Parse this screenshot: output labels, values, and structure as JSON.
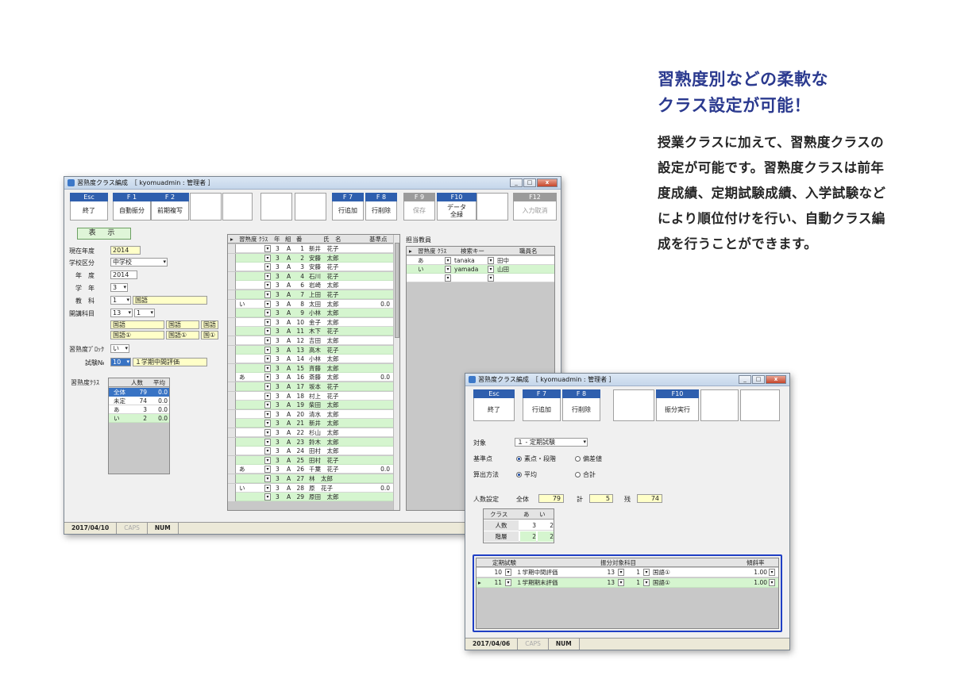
{
  "promo": {
    "headline": [
      "習熟度別などの柔軟な",
      "クラス設定が可能！"
    ],
    "body": "授業クラスに加えて、習熟度クラスの設定が可能です。習熟度クラスは前年度成績、定期試験成績、入学試験などにより順位付けを行い、自動クラス編成を行うことができます。"
  },
  "win1": {
    "title": "習熟度クラス編成　［ kyomuadmin : 管理者 ］",
    "fkeys": [
      {
        "key": "Esc",
        "label": "終了",
        "enabled": true
      },
      {
        "key": "F 1",
        "label": "自動振分",
        "enabled": true
      },
      {
        "key": "F 2",
        "label": "前期複写",
        "enabled": true
      },
      {
        "key": "F 7",
        "label": "行追加",
        "enabled": true
      },
      {
        "key": "F 8",
        "label": "行削除",
        "enabled": true
      },
      {
        "key": "F 9",
        "label": "保存",
        "enabled": false
      },
      {
        "key": "F10",
        "label": "データ\n全緑",
        "enabled": true
      },
      {
        "key": "F12",
        "label": "入力取消",
        "enabled": false
      }
    ],
    "show_button": "表 示",
    "form": {
      "current_year_label": "現在年度",
      "current_year": "2014",
      "school_type_label": "学校区分",
      "school_type": "中学校",
      "year_label": "年　度",
      "year": "2014",
      "grade_label": "学　年",
      "grade": "3",
      "subject_label": "教　科",
      "subject_code": "1",
      "subject_name": "国語",
      "course_label": "開講科目",
      "course_code": "13",
      "course_sub": "1",
      "course_names": [
        "国語",
        "国語",
        "国語",
        "国語①",
        "国語①",
        "国①"
      ],
      "block_label": "習熟度ﾌﾞﾛｯｸ",
      "block": "い",
      "exam_label": "試験№",
      "exam_no": "10",
      "exam_name": "１学期中間評価"
    },
    "summary": {
      "label": "習熟度ｸﾗｽ",
      "headers": [
        "人数",
        "平均"
      ],
      "rows": [
        {
          "name": "全体",
          "count": "79",
          "avg": "0.0"
        },
        {
          "name": "未定",
          "count": "74",
          "avg": "0.0"
        },
        {
          "name": "あ",
          "count": "3",
          "avg": "0.0"
        },
        {
          "name": "い",
          "count": "2",
          "avg": "0.0"
        }
      ]
    },
    "students": {
      "headers": [
        "習熟度 ｸﾗｽ",
        "年",
        "組",
        "番",
        "氏　名",
        "基準点"
      ],
      "rows": [
        {
          "cls": "",
          "y": "3",
          "k": "A",
          "n": "1",
          "name": "新井　花子",
          "pt": ""
        },
        {
          "cls": "",
          "y": "3",
          "k": "A",
          "n": "2",
          "name": "安藤　太郎",
          "pt": ""
        },
        {
          "cls": "",
          "y": "3",
          "k": "A",
          "n": "3",
          "name": "安藤　花子",
          "pt": ""
        },
        {
          "cls": "",
          "y": "3",
          "k": "A",
          "n": "4",
          "name": "石川　花子",
          "pt": ""
        },
        {
          "cls": "",
          "y": "3",
          "k": "A",
          "n": "6",
          "name": "岩崎　太郎",
          "pt": ""
        },
        {
          "cls": "",
          "y": "3",
          "k": "A",
          "n": "7",
          "name": "上田　花子",
          "pt": ""
        },
        {
          "cls": "い",
          "y": "3",
          "k": "A",
          "n": "8",
          "name": "太田　太郎",
          "pt": "0.0"
        },
        {
          "cls": "",
          "y": "3",
          "k": "A",
          "n": "9",
          "name": "小林　太郎",
          "pt": ""
        },
        {
          "cls": "",
          "y": "3",
          "k": "A",
          "n": "10",
          "name": "金子　太郎",
          "pt": ""
        },
        {
          "cls": "",
          "y": "3",
          "k": "A",
          "n": "11",
          "name": "木下　花子",
          "pt": ""
        },
        {
          "cls": "",
          "y": "3",
          "k": "A",
          "n": "12",
          "name": "吉田　太郎",
          "pt": ""
        },
        {
          "cls": "",
          "y": "3",
          "k": "A",
          "n": "13",
          "name": "高木　花子",
          "pt": ""
        },
        {
          "cls": "",
          "y": "3",
          "k": "A",
          "n": "14",
          "name": "小林　太郎",
          "pt": ""
        },
        {
          "cls": "",
          "y": "3",
          "k": "A",
          "n": "15",
          "name": "斉藤　太郎",
          "pt": ""
        },
        {
          "cls": "あ",
          "y": "3",
          "k": "A",
          "n": "16",
          "name": "斎藤　太郎",
          "pt": "0.0"
        },
        {
          "cls": "",
          "y": "3",
          "k": "A",
          "n": "17",
          "name": "坂本　花子",
          "pt": ""
        },
        {
          "cls": "",
          "y": "3",
          "k": "A",
          "n": "18",
          "name": "村上　花子",
          "pt": ""
        },
        {
          "cls": "",
          "y": "3",
          "k": "A",
          "n": "19",
          "name": "柴田　太郎",
          "pt": ""
        },
        {
          "cls": "",
          "y": "3",
          "k": "A",
          "n": "20",
          "name": "清水　太郎",
          "pt": ""
        },
        {
          "cls": "",
          "y": "3",
          "k": "A",
          "n": "21",
          "name": "新井　太郎",
          "pt": ""
        },
        {
          "cls": "",
          "y": "3",
          "k": "A",
          "n": "22",
          "name": "杉山　太郎",
          "pt": ""
        },
        {
          "cls": "",
          "y": "3",
          "k": "A",
          "n": "23",
          "name": "鈴木　太郎",
          "pt": ""
        },
        {
          "cls": "",
          "y": "3",
          "k": "A",
          "n": "24",
          "name": "田村　太郎",
          "pt": ""
        },
        {
          "cls": "",
          "y": "3",
          "k": "A",
          "n": "25",
          "name": "田村　花子",
          "pt": ""
        },
        {
          "cls": "あ",
          "y": "3",
          "k": "A",
          "n": "26",
          "name": "千葉　花子",
          "pt": "0.0"
        },
        {
          "cls": "",
          "y": "3",
          "k": "A",
          "n": "27",
          "name": "林　太郎",
          "pt": ""
        },
        {
          "cls": "い",
          "y": "3",
          "k": "A",
          "n": "28",
          "name": "原　花子",
          "pt": "0.0"
        },
        {
          "cls": "",
          "y": "3",
          "k": "A",
          "n": "29",
          "name": "原田　太郎",
          "pt": ""
        }
      ]
    },
    "teachers": {
      "label": "担当教員",
      "headers": [
        "習熟度 ｸﾗｽ",
        "検索キー",
        "職員名"
      ],
      "rows": [
        {
          "cls": "あ",
          "key": "tanaka",
          "name": "田中"
        },
        {
          "cls": "い",
          "key": "yamada",
          "name": "山田"
        },
        {
          "cls": "",
          "key": "",
          "name": ""
        }
      ]
    },
    "status": {
      "date": "2017/04/10",
      "caps": "CAPS",
      "num": "NUM"
    }
  },
  "win2": {
    "title": "習熟度クラス編成　［ kyomuadmin : 管理者 ］",
    "fkeys": [
      {
        "key": "Esc",
        "label": "終了"
      },
      {
        "key": "F 7",
        "label": "行追加"
      },
      {
        "key": "F 8",
        "label": "行削除"
      },
      {
        "key": "F10",
        "label": "振分実行"
      }
    ],
    "target_label": "対象",
    "target": "１ - 定期試験",
    "basis_label": "基準点",
    "basis_opt1": "素点・段階",
    "basis_opt2": "偏差値",
    "calc_label": "算出方法",
    "calc_opt1": "平均",
    "calc_opt2": "合計",
    "count_label": "人数設定",
    "total_label": "全体",
    "total": "79",
    "sum_label": "計",
    "sum": "5",
    "rest_label": "残",
    "rest": "74",
    "class_table": {
      "headers": [
        "クラス",
        "あ",
        "い"
      ],
      "rows": [
        {
          "label": "人数",
          "a": "3",
          "i": "2"
        },
        {
          "label": "階層",
          "a": "2",
          "i": "2"
        }
      ]
    },
    "exam_table": {
      "headers": [
        "定期試験",
        "振分対象科目",
        "傾斜率"
      ],
      "rows": [
        {
          "no": "10",
          "name": "１学期中間評価",
          "course": "13",
          "sub": "1",
          "subject": "国語①",
          "rate": "1.00"
        },
        {
          "no": "11",
          "name": "１学期期末評価",
          "course": "13",
          "sub": "1",
          "subject": "国語①",
          "rate": "1.00"
        }
      ]
    },
    "status": {
      "date": "2017/04/06",
      "caps": "CAPS",
      "num": "NUM"
    }
  }
}
